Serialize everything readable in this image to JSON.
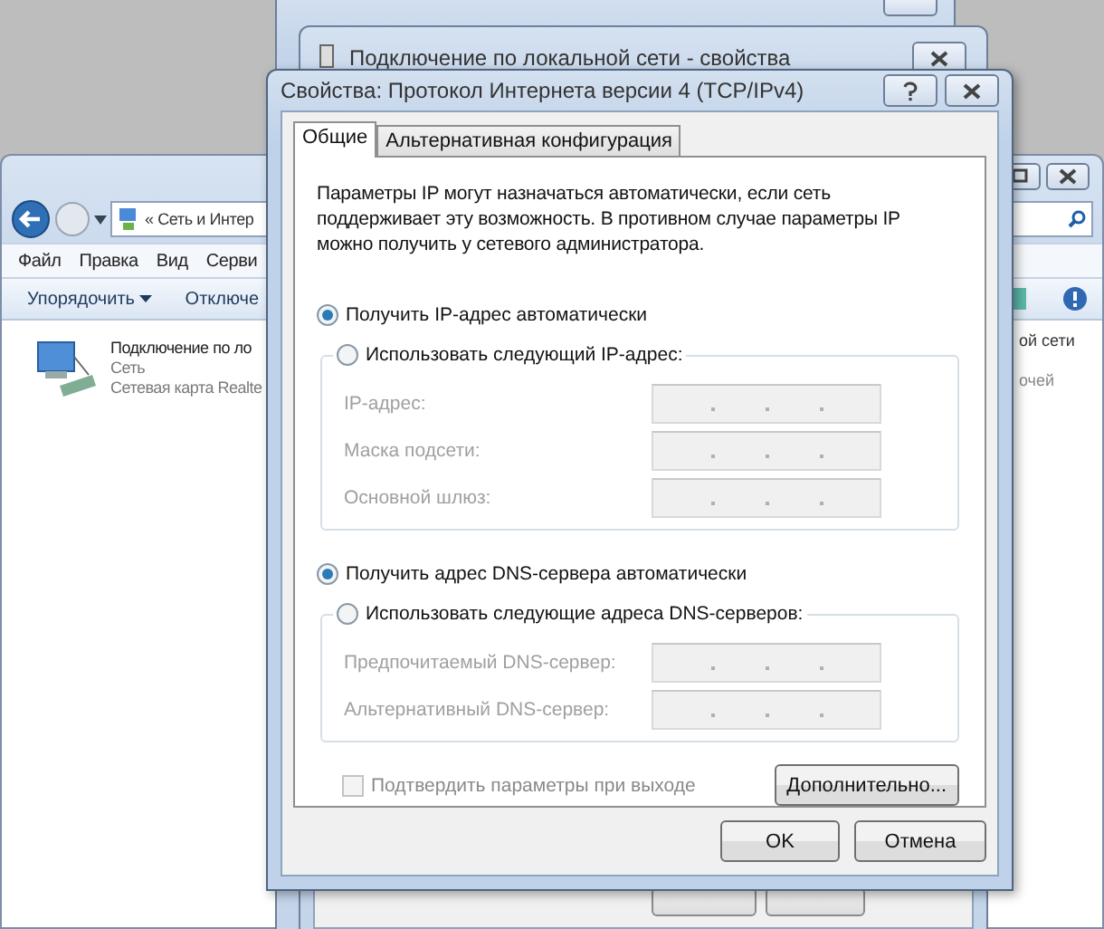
{
  "explorer": {
    "address": "« Сеть и Интер",
    "menu": [
      "Файл",
      "Правка",
      "Вид",
      "Серви"
    ],
    "toolbar": [
      {
        "label": "Упорядочить",
        "dropdown": true
      },
      {
        "label": "Отключе",
        "dropdown": false
      }
    ],
    "item": {
      "title": "Подключение по ло",
      "lines": [
        "Сеть",
        "Сетевая карта Realte"
      ]
    },
    "right_texts": [
      "ой сети",
      "очей"
    ]
  },
  "connection_dialog": {
    "title": "Подключение по локальной сети - свойства"
  },
  "ipv4_dialog": {
    "title": "Свойства: Протокол Интернета версии 4 (TCP/IPv4)",
    "tabs": [
      {
        "label": "Общие",
        "selected": true
      },
      {
        "label": "Альтернативная конфигурация",
        "selected": false
      }
    ],
    "description": "Параметры IP могут назначаться автоматически, если сеть поддерживает эту возможность. В противном случае параметры IP можно получить у сетевого администратора.",
    "ip_mode": [
      {
        "label": "Получить IP-адрес автоматически",
        "selected": true
      },
      {
        "label": "Использовать следующий IP-адрес:",
        "selected": false
      }
    ],
    "ip_fields": [
      {
        "label": "IP-адрес:",
        "disabled": true
      },
      {
        "label": "Маска подсети:",
        "disabled": true
      },
      {
        "label": "Основной шлюз:",
        "disabled": true
      }
    ],
    "dns_mode": [
      {
        "label": "Получить адрес DNS-сервера автоматически",
        "selected": true
      },
      {
        "label": "Использовать следующие адреса DNS-серверов:",
        "selected": false
      }
    ],
    "dns_fields": [
      {
        "label": "Предпочитаемый DNS-сервер:",
        "disabled": true
      },
      {
        "label": "Альтернативный DNS-сервер:",
        "disabled": true
      }
    ],
    "validate_on_exit": {
      "label": "Подтвердить параметры при выходе",
      "checked": false,
      "disabled": true
    },
    "advanced_button": "Дополнительно...",
    "buttons": [
      "OK",
      "Отмена"
    ]
  }
}
